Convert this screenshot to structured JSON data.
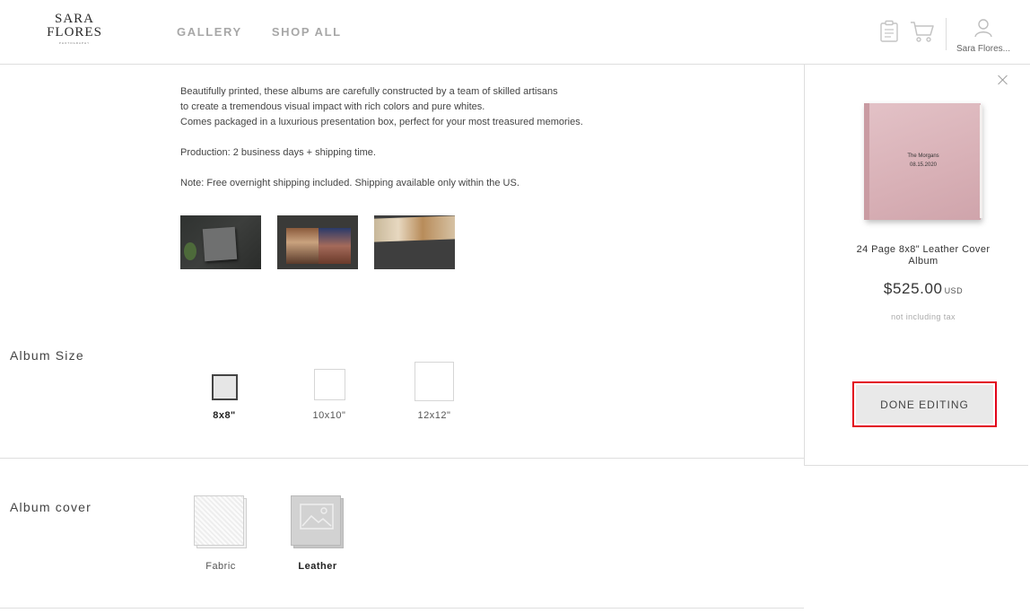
{
  "header": {
    "logo_line1": "SARA",
    "logo_line2": "FLORES",
    "logo_line3": "PHOTOGRAPHY",
    "nav": [
      "GALLERY",
      "SHOP ALL"
    ],
    "account_name": "Sara Flores..."
  },
  "description": {
    "lines1": [
      "Beautifully printed, these albums are carefully constructed by a team of skilled artisans",
      "to create a tremendous visual impact with rich colors and pure whites.",
      "Comes packaged in a luxurious presentation box, perfect for your most treasured memories."
    ],
    "production": "Production: 2 business days + shipping time.",
    "note": "Note: Free overnight shipping included. Shipping available only within the US."
  },
  "album_size": {
    "label": "Album Size",
    "options": [
      "8x8\"",
      "10x10\"",
      "12x12\""
    ],
    "selected": "8x8\""
  },
  "album_cover": {
    "label": "Album cover",
    "options": [
      "Fabric",
      "Leather"
    ],
    "selected": "Leather"
  },
  "summary": {
    "cover_text_line1": "The Morgans",
    "cover_text_line2": "08.15.2020",
    "product_title": "24 Page 8x8\" Leather Cover Album",
    "price": "$525.00",
    "currency": "USD",
    "tax_note": "not including tax",
    "done_label": "DONE EDITING"
  },
  "colors": {
    "accent_outline": "#e2001a",
    "cover_color": "#d8b0b6"
  }
}
